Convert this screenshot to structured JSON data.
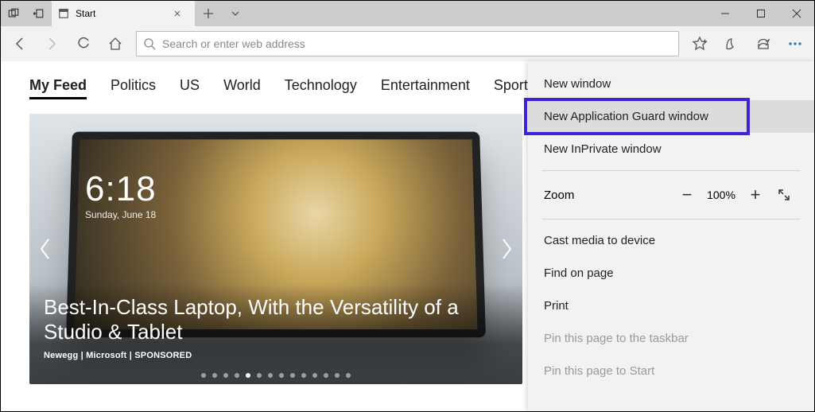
{
  "window": {
    "tab_title": "Start"
  },
  "toolbar": {
    "address_placeholder": "Search or enter web address"
  },
  "feed": {
    "tabs": [
      "My Feed",
      "Politics",
      "US",
      "World",
      "Technology",
      "Entertainment",
      "Sports"
    ],
    "active_tab_index": 0,
    "hero": {
      "clock_time": "6:18",
      "clock_date": "Sunday, June 18",
      "headline": "Best-In-Class Laptop, With the Versatility of a Studio & Tablet",
      "byline": "Newegg | Microsoft | SPONSORED",
      "dot_count": 14,
      "active_dot_index": 4
    }
  },
  "menu": {
    "items": {
      "new_window": "New window",
      "new_app_guard": "New Application Guard window",
      "new_inprivate": "New InPrivate window",
      "zoom_label": "Zoom",
      "zoom_value": "100%",
      "cast": "Cast media to device",
      "find": "Find on page",
      "print": "Print",
      "pin_taskbar": "Pin this page to the taskbar",
      "pin_start": "Pin this page to Start"
    },
    "highlighted": "new_app_guard"
  }
}
